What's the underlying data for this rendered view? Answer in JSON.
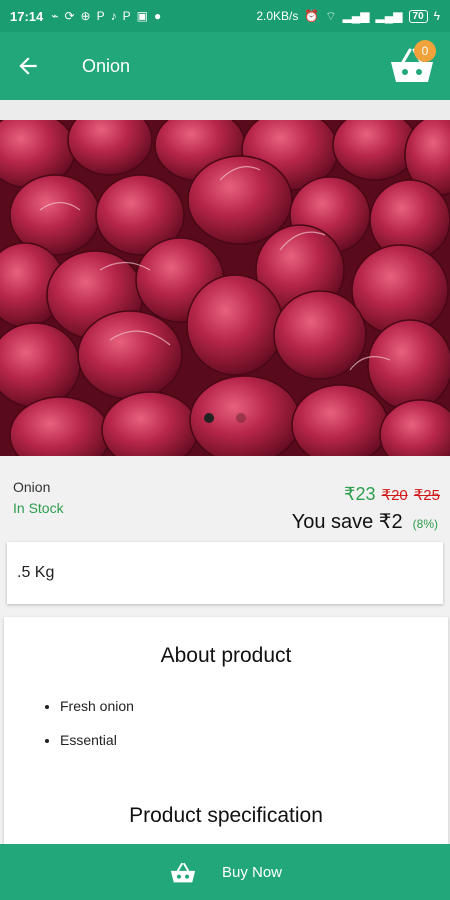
{
  "status_bar": {
    "time": "17:14",
    "left_icons": [
      "usb-icon",
      "sync-icon",
      "app-icon",
      "paytm-icon",
      "tiktok-icon",
      "paytm-icon",
      "app-icon",
      "drop-icon"
    ],
    "speed": "2.0KB/s",
    "right_icons": [
      "alarm-icon",
      "wifi-icon",
      "signal-icon",
      "signal-icon"
    ],
    "battery": "70"
  },
  "app_bar": {
    "title": "Onion",
    "cart_count": "0"
  },
  "product": {
    "name": "Onion",
    "stock": "In Stock",
    "price_now": "₹23",
    "price_old_1": "₹20",
    "price_old_2": "₹25",
    "save_text": "You save ₹2",
    "save_percent": "(8%)"
  },
  "carousel": {
    "dots": [
      {
        "active": true
      },
      {
        "active": false
      }
    ]
  },
  "variant": {
    "label": ".5 Kg"
  },
  "about": {
    "heading": "About product",
    "bullets": [
      "Fresh onion",
      "Essential"
    ],
    "spec_heading": "Product specification"
  },
  "buy_bar": {
    "label": "Buy Now"
  },
  "colors": {
    "primary": "#21a77a",
    "status": "#1b9d72",
    "accent_badge": "#f2a23a",
    "green_text": "#2e9e4f",
    "red_strike": "#d11b1b"
  }
}
